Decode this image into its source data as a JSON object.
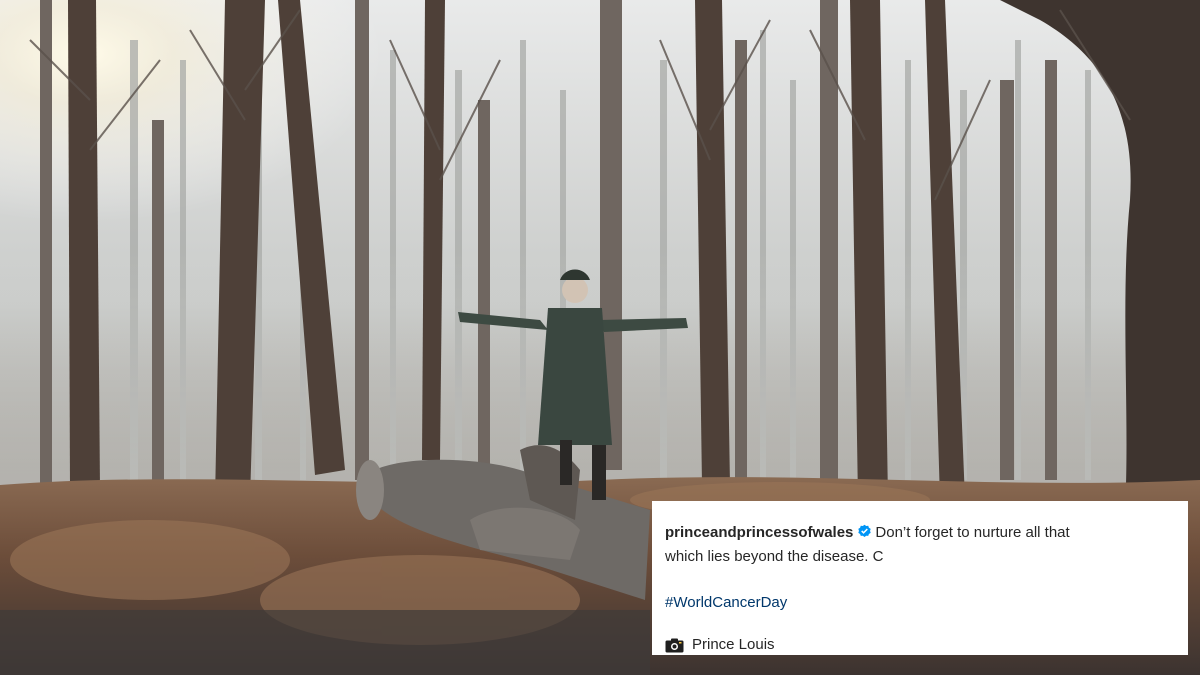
{
  "post": {
    "username": "princeandprincessofwales",
    "caption_text": "Don’t forget to nurture all that which lies beyond the disease. C",
    "caption_line1": "Don’t forget to nurture all that",
    "caption_line2": "which lies beyond the disease. C",
    "hashtag": "#WorldCancerDay",
    "photo_credit": "Prince Louis"
  },
  "icons": {
    "verified": "verified-badge-icon",
    "camera": "camera-icon"
  },
  "colors": {
    "verified_blue": "#0095f6",
    "hashtag_link": "#00376b",
    "text": "#262626",
    "card_bg": "#ffffff"
  }
}
